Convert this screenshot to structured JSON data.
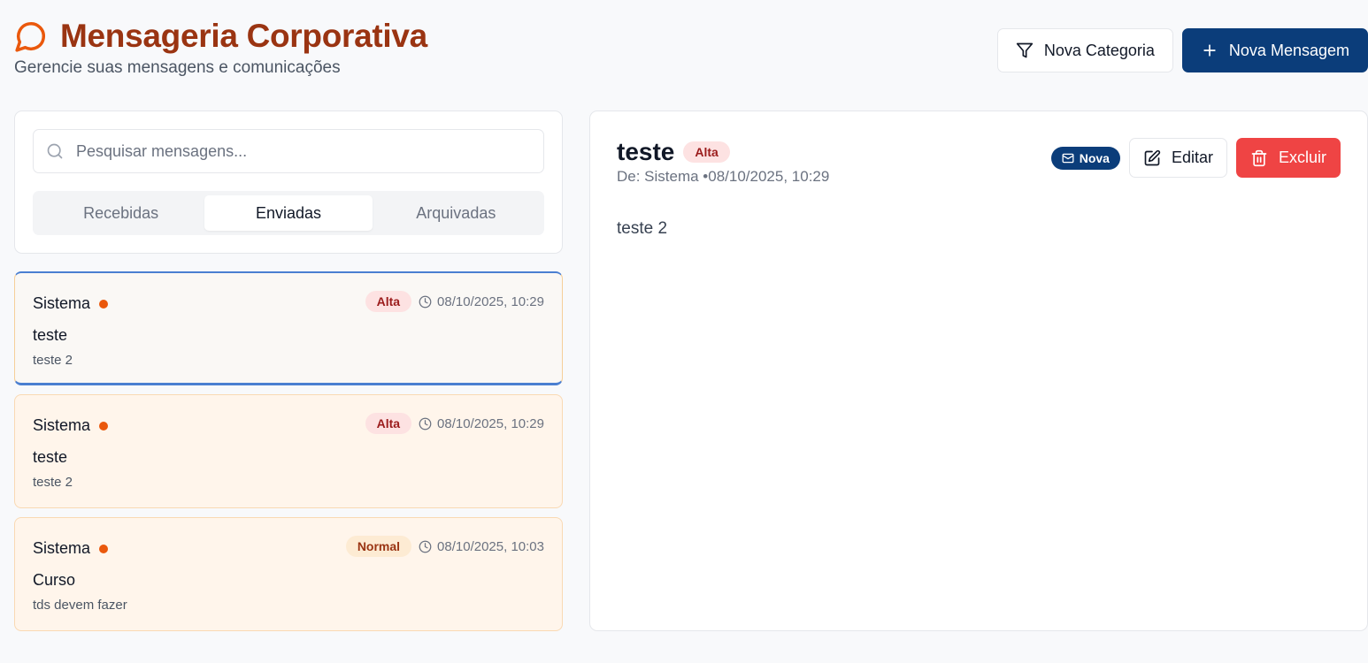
{
  "header": {
    "title": "Mensageria Corporativa",
    "subtitle": "Gerencie suas mensagens e comunicações",
    "icon": "chat-bubble-icon",
    "accent_color": "#9a3412"
  },
  "top_actions": {
    "new_category_label": "Nova Categoria",
    "new_message_label": "Nova Mensagem"
  },
  "search": {
    "placeholder": "Pesquisar mensagens...",
    "value": ""
  },
  "tabs": [
    {
      "label": "Recebidas",
      "active": false
    },
    {
      "label": "Enviadas",
      "active": true
    },
    {
      "label": "Arquivadas",
      "active": false
    }
  ],
  "messages": [
    {
      "sender": "Sistema",
      "priority": "Alta",
      "date": "08/10/2025, 10:29",
      "subject": "teste",
      "preview": "teste 2",
      "selected": true
    },
    {
      "sender": "Sistema",
      "priority": "Alta",
      "date": "08/10/2025, 10:29",
      "subject": "teste",
      "preview": "teste 2",
      "selected": false
    },
    {
      "sender": "Sistema",
      "priority": "Normal",
      "date": "08/10/2025, 10:03",
      "subject": "Curso",
      "preview": "tds devem fazer",
      "selected": false
    }
  ],
  "detail": {
    "title": "teste",
    "priority": "Alta",
    "meta": "De: Sistema •08/10/2025, 10:29",
    "status_badge": "Nova",
    "edit_label": "Editar",
    "delete_label": "Excluir",
    "body": "teste 2"
  },
  "colors": {
    "primary": "#0b3d7a",
    "danger": "#ef4444",
    "unread_dot": "#ea580c"
  }
}
